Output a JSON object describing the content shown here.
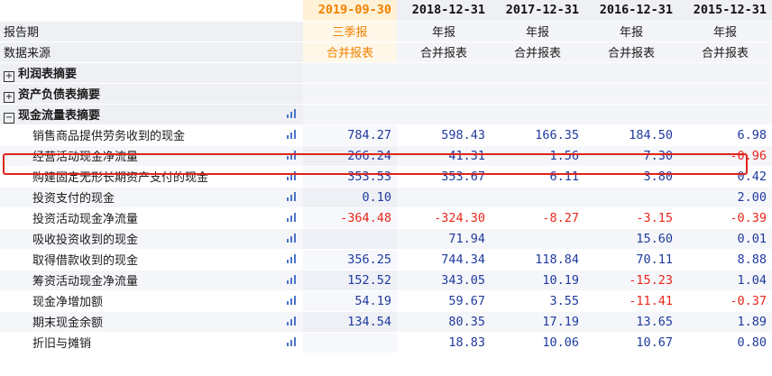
{
  "periods": [
    {
      "date": "2019-09-30",
      "type": "三季报",
      "source": "合并报表",
      "active": true
    },
    {
      "date": "2018-12-31",
      "type": "年报",
      "source": "合并报表",
      "active": false
    },
    {
      "date": "2017-12-31",
      "type": "年报",
      "source": "合并报表",
      "active": false
    },
    {
      "date": "2016-12-31",
      "type": "年报",
      "source": "合并报表",
      "active": false
    },
    {
      "date": "2015-12-31",
      "type": "年报",
      "source": "合并报表",
      "active": false
    }
  ],
  "meta_labels": {
    "period": "报告期",
    "source": "数据来源"
  },
  "sections": [
    {
      "label": "利润表摘要",
      "toggle": "⊞"
    },
    {
      "label": "资产负债表摘要",
      "toggle": "⊞"
    },
    {
      "label": "现金流量表摘要",
      "toggle": "⊟"
    }
  ],
  "rows": [
    {
      "label": "销售商品提供劳务收到的现金",
      "values": [
        "784.27",
        "598.43",
        "166.35",
        "184.50",
        "6.98"
      ]
    },
    {
      "label": "经营活动现金净流量",
      "values": [
        "266.24",
        "41.31",
        "1.56",
        "7.30",
        "-0.96"
      ],
      "highlighted": true
    },
    {
      "label": "购建固定无形长期资产支付的现金",
      "values": [
        "353.53",
        "353.67",
        "6.11",
        "3.80",
        "0.42"
      ]
    },
    {
      "label": "投资支付的现金",
      "values": [
        "0.10",
        "",
        "",
        "",
        "2.00"
      ]
    },
    {
      "label": "投资活动现金净流量",
      "values": [
        "-364.48",
        "-324.30",
        "-8.27",
        "-3.15",
        "-0.39"
      ]
    },
    {
      "label": "吸收投资收到的现金",
      "values": [
        "",
        "71.94",
        "",
        "15.60",
        "0.01"
      ]
    },
    {
      "label": "取得借款收到的现金",
      "values": [
        "356.25",
        "744.34",
        "118.84",
        "70.11",
        "8.88"
      ]
    },
    {
      "label": "筹资活动现金净流量",
      "values": [
        "152.52",
        "343.05",
        "10.19",
        "-15.23",
        "1.04"
      ]
    },
    {
      "label": "现金净增加额",
      "values": [
        "54.19",
        "59.67",
        "3.55",
        "-11.41",
        "-0.37"
      ]
    },
    {
      "label": "期末现金余额",
      "values": [
        "134.54",
        "80.35",
        "17.19",
        "13.65",
        "1.89"
      ]
    },
    {
      "label": "折旧与摊销",
      "values": [
        "",
        "18.83",
        "10.06",
        "10.67",
        "0.80"
      ]
    }
  ],
  "colors": {
    "accent": "#f08200",
    "value": "#1f3a9e",
    "negative": "#e8261b",
    "highlight_border": "#e0231b"
  },
  "icons": {
    "chart": "bar-chart-icon",
    "expand": "plus-box-icon",
    "collapse": "minus-box-icon"
  }
}
